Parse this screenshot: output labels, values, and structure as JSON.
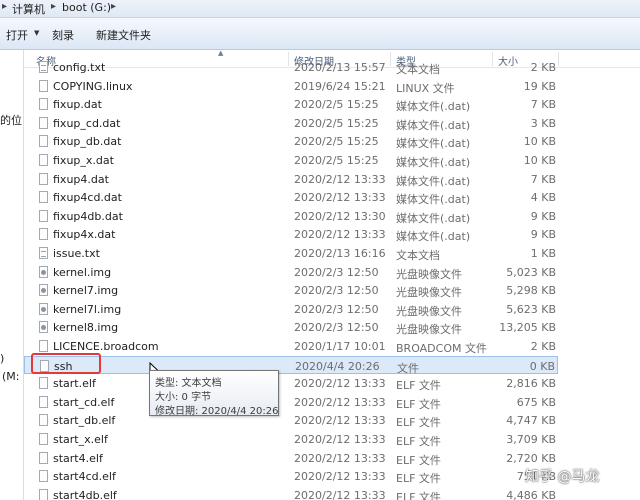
{
  "address": {
    "crumbs": [
      "计算机",
      "boot (G:)"
    ],
    "separator": "▸"
  },
  "toolbar": {
    "open_label": "打开",
    "burn_label": "刻录",
    "new_folder_label": "新建文件夹"
  },
  "nav": {
    "fragments": [
      "的位",
      ")",
      "(M:"
    ]
  },
  "columns": {
    "name": "名称",
    "date": "修改日期",
    "type": "类型",
    "size": "大小"
  },
  "files": [
    {
      "name": "config.txt",
      "date": "2020/2/13 15:57",
      "type": "文本文档",
      "size": "2 KB",
      "icon": "txt"
    },
    {
      "name": "COPYING.linux",
      "date": "2019/6/24 15:21",
      "type": "LINUX 文件",
      "size": "19 KB",
      "icon": "file"
    },
    {
      "name": "fixup.dat",
      "date": "2020/2/5 15:25",
      "type": "媒体文件(.dat)",
      "size": "7 KB",
      "icon": "file"
    },
    {
      "name": "fixup_cd.dat",
      "date": "2020/2/5 15:25",
      "type": "媒体文件(.dat)",
      "size": "3 KB",
      "icon": "file"
    },
    {
      "name": "fixup_db.dat",
      "date": "2020/2/5 15:25",
      "type": "媒体文件(.dat)",
      "size": "10 KB",
      "icon": "file"
    },
    {
      "name": "fixup_x.dat",
      "date": "2020/2/5 15:25",
      "type": "媒体文件(.dat)",
      "size": "10 KB",
      "icon": "file"
    },
    {
      "name": "fixup4.dat",
      "date": "2020/2/12 13:33",
      "type": "媒体文件(.dat)",
      "size": "7 KB",
      "icon": "file"
    },
    {
      "name": "fixup4cd.dat",
      "date": "2020/2/12 13:33",
      "type": "媒体文件(.dat)",
      "size": "4 KB",
      "icon": "file"
    },
    {
      "name": "fixup4db.dat",
      "date": "2020/2/12 13:30",
      "type": "媒体文件(.dat)",
      "size": "9 KB",
      "icon": "file"
    },
    {
      "name": "fixup4x.dat",
      "date": "2020/2/12 13:33",
      "type": "媒体文件(.dat)",
      "size": "9 KB",
      "icon": "file"
    },
    {
      "name": "issue.txt",
      "date": "2020/2/13 16:16",
      "type": "文本文档",
      "size": "1 KB",
      "icon": "txt"
    },
    {
      "name": "kernel.img",
      "date": "2020/2/3 12:50",
      "type": "光盘映像文件",
      "size": "5,023 KB",
      "icon": "gear"
    },
    {
      "name": "kernel7.img",
      "date": "2020/2/3 12:50",
      "type": "光盘映像文件",
      "size": "5,298 KB",
      "icon": "gear"
    },
    {
      "name": "kernel7l.img",
      "date": "2020/2/3 12:50",
      "type": "光盘映像文件",
      "size": "5,623 KB",
      "icon": "gear"
    },
    {
      "name": "kernel8.img",
      "date": "2020/2/3 12:50",
      "type": "光盘映像文件",
      "size": "13,205 KB",
      "icon": "gear"
    },
    {
      "name": "LICENCE.broadcom",
      "date": "2020/1/17 10:01",
      "type": "BROADCOM 文件",
      "size": "2 KB",
      "icon": "file"
    },
    {
      "name": "ssh",
      "date": "2020/4/4 20:26",
      "type": "文件",
      "size": "0 KB",
      "icon": "file",
      "selected": true
    },
    {
      "name": "start.elf",
      "date": "2020/2/12 13:33",
      "type": "ELF 文件",
      "size": "2,816 KB",
      "icon": "file"
    },
    {
      "name": "start_cd.elf",
      "date": "2020/2/12 13:33",
      "type": "ELF 文件",
      "size": "675 KB",
      "icon": "file"
    },
    {
      "name": "start_db.elf",
      "date": "2020/2/12 13:33",
      "type": "ELF 文件",
      "size": "4,747 KB",
      "icon": "file"
    },
    {
      "name": "start_x.elf",
      "date": "2020/2/12 13:33",
      "type": "ELF 文件",
      "size": "3,709 KB",
      "icon": "file"
    },
    {
      "name": "start4.elf",
      "date": "2020/2/12 13:33",
      "type": "ELF 文件",
      "size": "2,720 KB",
      "icon": "file"
    },
    {
      "name": "start4cd.elf",
      "date": "2020/2/12 13:33",
      "type": "ELF 文件",
      "size": "751 KB",
      "icon": "file"
    },
    {
      "name": "start4db.elf",
      "date": "2020/2/12 13:33",
      "type": "ELF 文件",
      "size": "4,486 KB",
      "icon": "file"
    }
  ],
  "tooltip": {
    "type_line": "类型: 文本文档",
    "size_line": "大小: 0 字节",
    "date_line": "修改日期: 2020/4/4 20:26"
  },
  "watermark": "知乎 @马龙",
  "colors": {
    "highlight_border": "#e03a3a",
    "selection_bg": "#dce9f8",
    "selection_border": "#9cc0ea"
  }
}
